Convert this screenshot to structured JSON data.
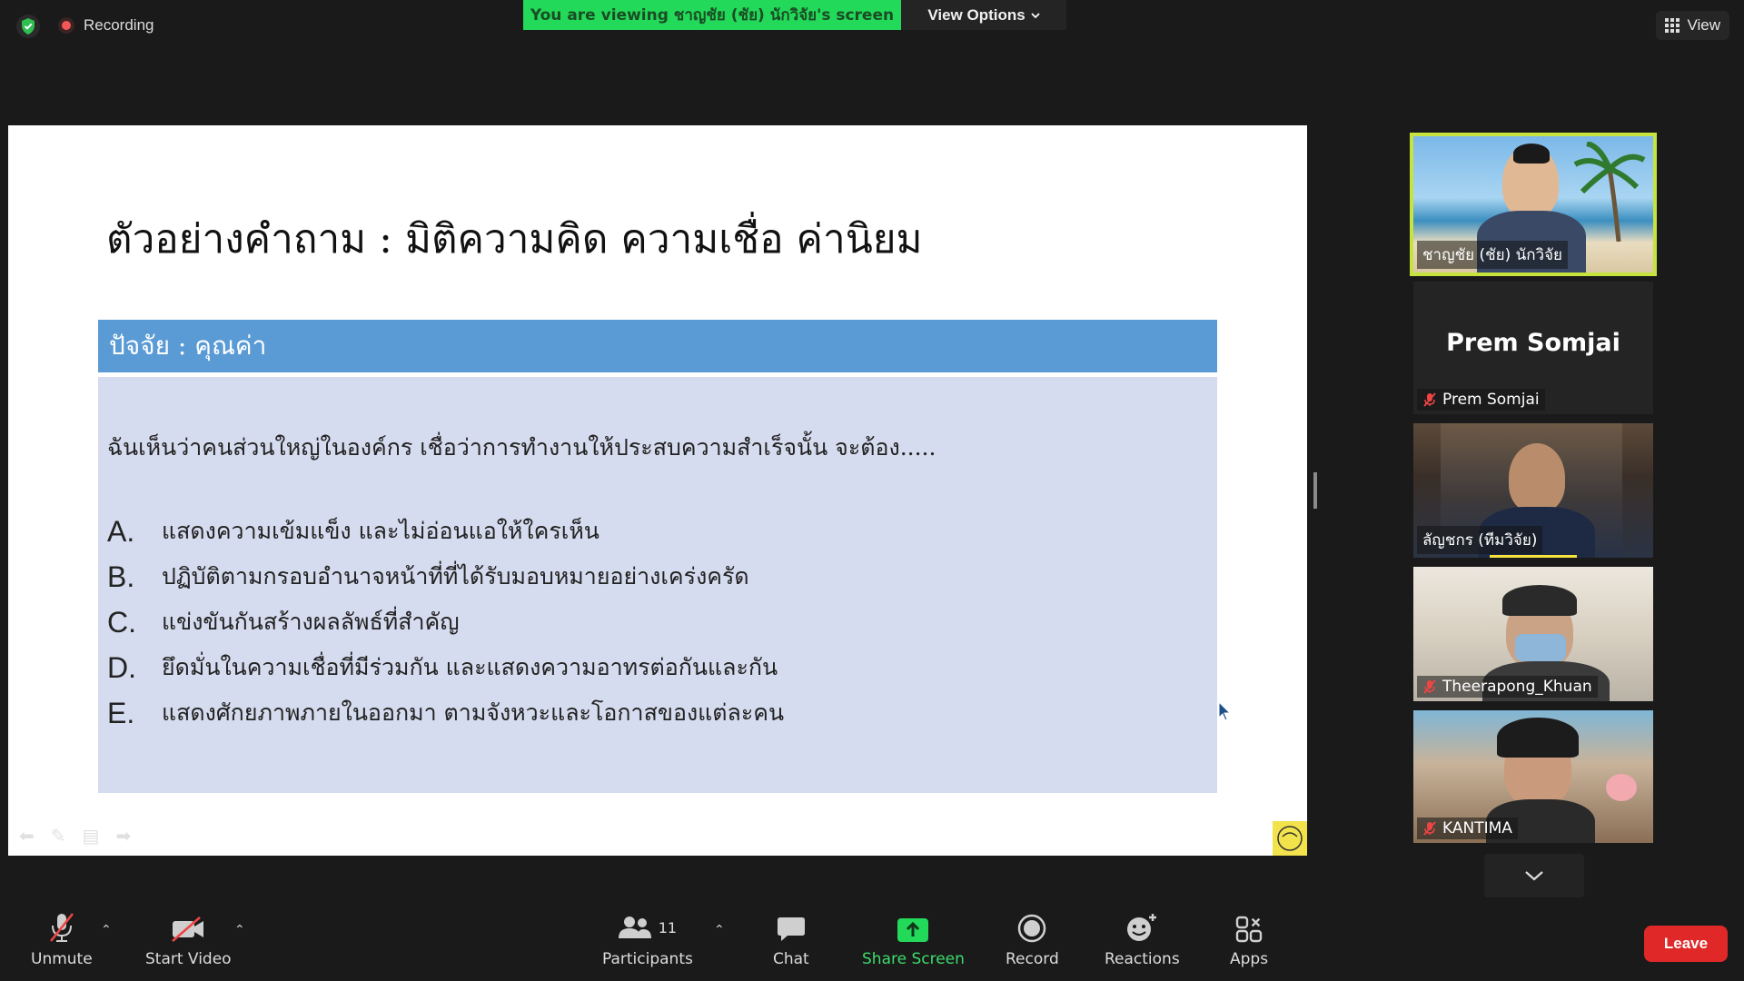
{
  "top_bar": {
    "recording_label": "Recording",
    "viewing_banner": "You are viewing ชาญชัย (ชัย) นักวิจัย's screen",
    "view_options_label": "View Options",
    "view_label": "View"
  },
  "slide": {
    "title": "ตัวอย่างคำถาม : มิติความคิด ความเชื่อ ค่านิยม",
    "factor": "ปัจจัย : คุณค่า",
    "question": "ฉันเห็นว่าคนส่วนใหญ่ในองค์กร เชื่อว่าการทำงานให้ประสบความสำเร็จนั้น จะต้อง.....",
    "options": [
      {
        "letter": "A.",
        "text": "แสดงความเข้มแข็ง และไม่อ่อนแอให้ใครเห็น"
      },
      {
        "letter": "B.",
        "text": "ปฏิบัติตามกรอบอำนาจหน้าที่ที่ได้รับมอบหมายอย่างเคร่งครัด"
      },
      {
        "letter": "C.",
        "text": "แข่งขันกันสร้างผลลัพธ์ที่สำคัญ"
      },
      {
        "letter": "D.",
        "text": "ยึดมั่นในความเชื่อที่มีร่วมกัน และแสดงความอาทรต่อกันและกัน"
      },
      {
        "letter": "E.",
        "text": "แสดงศักยภาพภายในออกมา ตามจังหวะและโอกาสของแต่ละคน"
      }
    ]
  },
  "participants": [
    {
      "name": "ชาญชัย (ชัย) นักวิจัย",
      "muted": false,
      "active_speaker": true
    },
    {
      "name": "Prem Somjai",
      "display_big": "Prem Somjai",
      "muted": true
    },
    {
      "name": "ลัญชกร (ทีมวิจัย)",
      "muted": false
    },
    {
      "name": "Theerapong_Khuan",
      "muted": true
    },
    {
      "name": "KANTIMA",
      "muted": true
    }
  ],
  "toolbar": {
    "unmute": "Unmute",
    "start_video": "Start Video",
    "participants": "Participants",
    "participant_count": "11",
    "chat": "Chat",
    "share_screen": "Share Screen",
    "record": "Record",
    "reactions": "Reactions",
    "apps": "Apps",
    "leave": "Leave"
  },
  "colors": {
    "banner_green": "#23d959",
    "active_speaker_border": "#c6e33e",
    "leave_red": "#e02828",
    "share_green": "#23d959",
    "factor_blue": "#5b9bd5",
    "question_bg": "#d6dcef"
  }
}
